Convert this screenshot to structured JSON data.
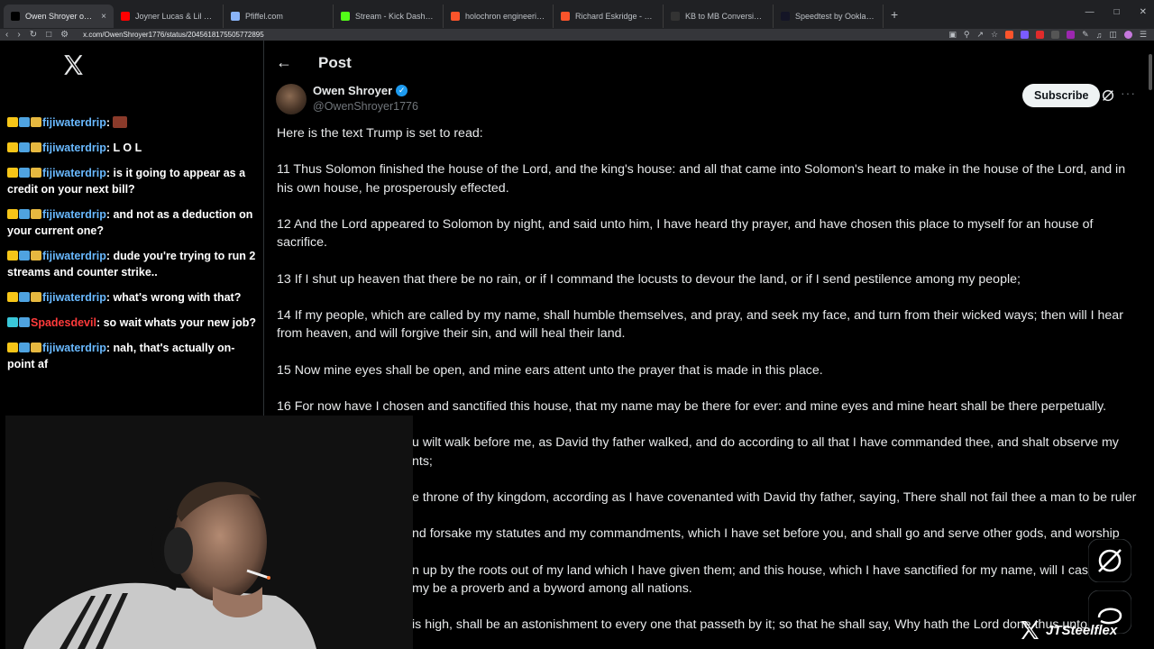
{
  "browser": {
    "tabs": [
      {
        "title": "Owen Shroyer on X: \"Here is the",
        "favicon": "x",
        "active": true,
        "color": "#000000"
      },
      {
        "title": "Joyner Lucas & Lil Baby - Ramen & O",
        "favicon": "youtube",
        "active": false,
        "color": "#ff0000"
      },
      {
        "title": "Pfiffel.com",
        "favicon": "globe",
        "active": false,
        "color": "#8ab4f8"
      },
      {
        "title": "Stream - Kick Dashboard",
        "favicon": "kick",
        "active": false,
        "color": "#53fc18"
      },
      {
        "title": "holochron engineering - Brave Search",
        "favicon": "brave",
        "active": false,
        "color": "#fb542b"
      },
      {
        "title": "Richard Eskridge - Brave Search",
        "favicon": "brave",
        "active": false,
        "color": "#fb542b"
      },
      {
        "title": "KB to MB Conversion Kilobytes to M",
        "favicon": "converter",
        "active": false,
        "color": "#333333"
      },
      {
        "title": "Speedtest by Ookla - The Global Bro",
        "favicon": "speedtest",
        "active": false,
        "color": "#141526"
      }
    ],
    "new_tab_label": "+",
    "url": "x.com/OwenShroyer1776/status/2045618175505772895"
  },
  "sidebar": {
    "logo": "x-logo-icon",
    "chat": [
      {
        "user": "fijiwaterdrip",
        "user_color": "#69b9ff",
        "message": "",
        "emote": true
      },
      {
        "user": "fijiwaterdrip",
        "user_color": "#69b9ff",
        "message": "L O L"
      },
      {
        "user": "fijiwaterdrip",
        "user_color": "#69b9ff",
        "message": "is it going to appear as a credit on your next bill?"
      },
      {
        "user": "fijiwaterdrip",
        "user_color": "#69b9ff",
        "message": "and not as a deduction on your current one?"
      },
      {
        "user": "fijiwaterdrip",
        "user_color": "#69b9ff",
        "message": "dude you're trying to run 2 streams and counter strike.."
      },
      {
        "user": "fijiwaterdrip",
        "user_color": "#69b9ff",
        "message": "what's wrong with that?"
      },
      {
        "user": "Spadesdevil",
        "user_color": "#ff3b3b",
        "message": "so wait whats your new job?"
      },
      {
        "user": "fijiwaterdrip",
        "user_color": "#69b9ff",
        "message": "nah, that's actually on-point af"
      }
    ]
  },
  "header": {
    "back_icon": "arrow-left-icon",
    "title": "Post"
  },
  "post": {
    "author_name": "Owen Shroyer",
    "author_handle": "@OwenShroyer1776",
    "verified": true,
    "subscribe_label": "Subscribe",
    "more_label": "···",
    "paragraphs": [
      "Here is the text Trump is set to read:",
      "11 Thus Solomon finished the house of the Lord, and the king's house: and all that came into Solomon's heart to make in the house of the Lord, and in his own house, he prosperously effected.",
      "12 And the Lord appeared to Solomon by night, and said unto him, I have heard thy prayer, and have chosen this place to myself for an house of sacrifice.",
      "13 If I shut up heaven that there be no rain, or if I command the locusts to devour the land, or if I send pestilence among my people;",
      "14 If my people, which are called by my name, shall humble themselves, and pray, and seek my face, and turn from their wicked ways; then will I hear from heaven, and will forgive their sin, and will heal their land.",
      "15 Now mine eyes shall be open, and mine ears attent unto the prayer that is made in this place.",
      "16 For now have I chosen and sanctified this house, that my name may be there for ever: and mine eyes and mine heart shall be there perpetually."
    ],
    "obscured_paragraphs": [
      "u wilt walk before me, as David thy father walked, and do according to all that I have commanded thee, and shalt observe my nts;",
      "e throne of thy kingdom, according as I have covenanted with David thy father, saying, There shall not fail thee a man to be ruler",
      "nd forsake my statutes and my commandments, which I have set before you, and shall go and serve other gods, and worship",
      "n up by the roots out of my land which I have given them; and this house, which I have sanctified for my name, will I cast out of my be a proverb and a byword among all nations.",
      "is high, shall be an astonishment to every one that passeth by it; so that he shall say, Why hath the Lord done thus unto this"
    ]
  },
  "overlay": {
    "streamer_name": "JTSteelflex"
  },
  "colors": {
    "background": "#000000",
    "text": "#e7e9ea",
    "muted": "#71767b",
    "verified": "#1d9bf0",
    "subscribe_bg": "#eff3f4"
  }
}
